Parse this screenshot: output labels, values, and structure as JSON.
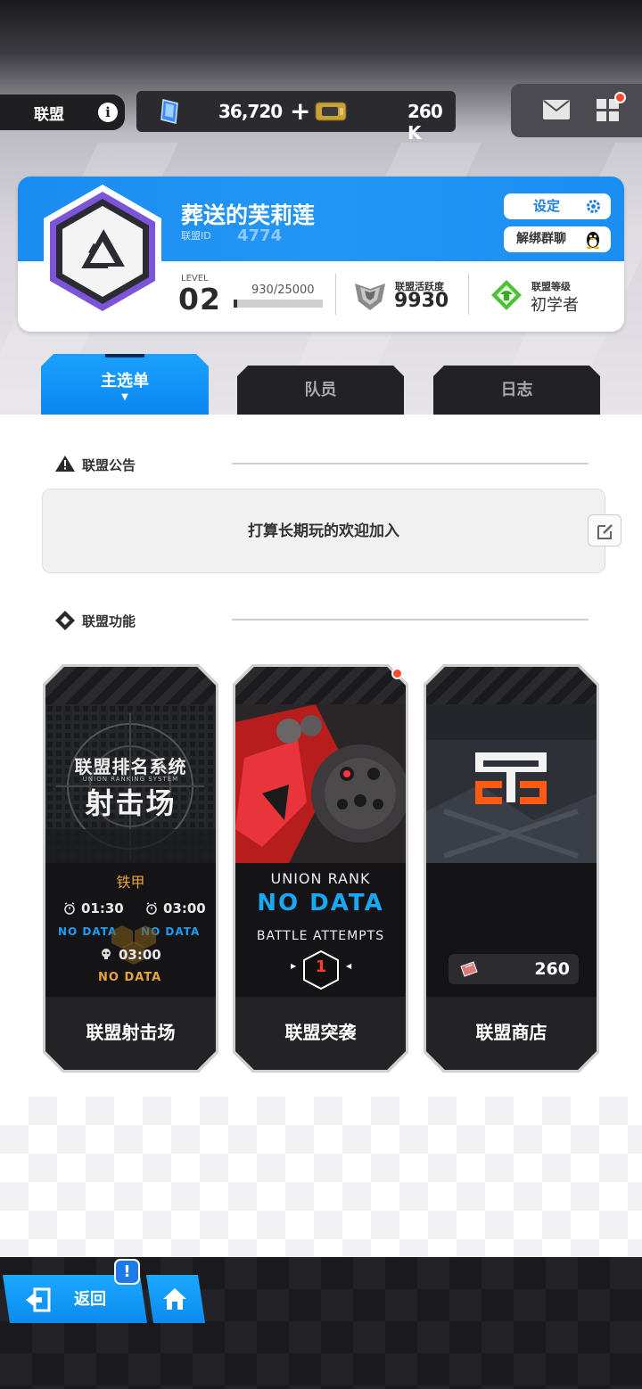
{
  "header": {
    "guild_tab_label": "联盟",
    "gems": "36,720",
    "gem_plus": "+",
    "credits": "260 K"
  },
  "guild": {
    "name": "葬送的芙莉莲",
    "id_label": "联盟ID",
    "id": "4774",
    "setting_label": "设定",
    "unbind_label": "解绑群聊",
    "level_label": "LEVEL",
    "level": "02",
    "exp_text": "930/25000",
    "exp_fraction": 0.0372,
    "activity_label": "联盟活跃度",
    "activity_value": "9930",
    "rank_label": "联盟等级",
    "rank_value": "初学者"
  },
  "tabs": [
    {
      "label": "主选单",
      "active": true
    },
    {
      "label": "队员",
      "active": false
    },
    {
      "label": "日志",
      "active": false
    }
  ],
  "announcement": {
    "title": "联盟公告",
    "text": "打算长期玩的欢迎加入"
  },
  "functions": {
    "title": "联盟功能",
    "cards": [
      {
        "title": "联盟射击场",
        "img_title1": "联盟排名系统",
        "img_sub": "UNION RANKING SYSTEM",
        "img_title2": "射击场",
        "tier": "铁甲",
        "time1": "01:30",
        "time2": "03:00",
        "time3": "03:00",
        "nodata1": "NO DATA",
        "nodata2": "NO DATA",
        "nodata3": "NO DATA"
      },
      {
        "title": "联盟突袭",
        "rank_label": "UNION RANK",
        "rank_value": "NO DATA",
        "battle_label": "BATTLE ATTEMPTS",
        "attempts": "1"
      },
      {
        "title": "联盟商店",
        "cost": "260"
      }
    ]
  },
  "bottom": {
    "back_label": "返回",
    "alert": "!"
  },
  "colors": {
    "accent_blue": "#1a8cf0",
    "notify_red": "#ff4a2a",
    "tier_orange": "#e8a33a"
  }
}
